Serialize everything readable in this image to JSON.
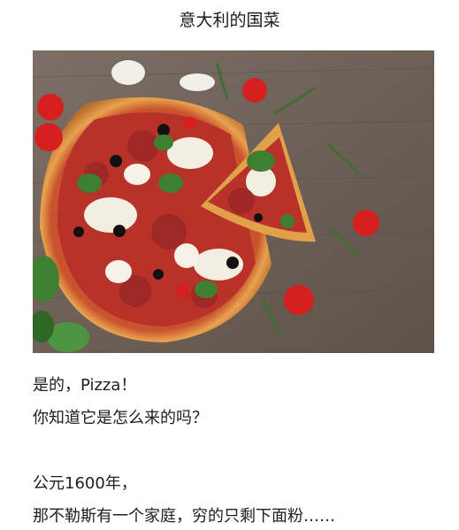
{
  "article": {
    "title": "意大利的国菜",
    "image_subject": "pizza-photo",
    "paragraphs": [
      "是的，Pizza！",
      "你知道它是怎么来的吗？",
      "公元1600年，",
      "那不勒斯有一个家庭，穷的只剩下面粉……"
    ]
  },
  "colors": {
    "board": "#6f6258",
    "crust": "#d9893a",
    "sauce": "#b8322a",
    "cheese": "#f3eee2",
    "tomato": "#d61f1f",
    "basil": "#3f7f33"
  }
}
